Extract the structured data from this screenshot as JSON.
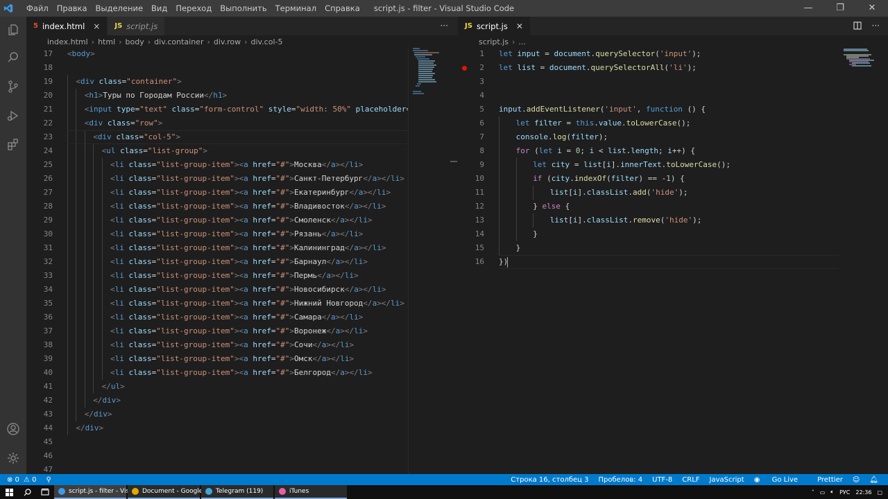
{
  "window": {
    "title": "script.js - filter - Visual Studio Code",
    "menu": [
      "Файл",
      "Правка",
      "Выделение",
      "Вид",
      "Переход",
      "Выполнить",
      "Терминал",
      "Справка"
    ],
    "controls": {
      "minimize": "—",
      "restore": "❐",
      "close": "✕"
    }
  },
  "left_editor": {
    "tabs": [
      {
        "label": "index.html",
        "icon": "html-file-icon",
        "close": "×",
        "active": true
      },
      {
        "label": "script.js",
        "icon": "js-file-icon",
        "active": false
      }
    ],
    "more": "···",
    "breadcrumb": [
      "index.html",
      "html",
      "body",
      "div.container",
      "div.row",
      "div.col-5"
    ],
    "lines": [
      {
        "n": "17",
        "html": "<span class='br'>&lt;</span><span class='tg'>body</span><span class='br'>&gt;</span>",
        "indent": 0
      },
      {
        "n": "18",
        "html": "",
        "indent": 0
      },
      {
        "n": "19",
        "html": "<span class='br'>&lt;</span><span class='tg'>div</span> <span class='at'>class</span><span class='pl'>=</span><span class='st'>\"container\"</span><span class='br'>&gt;</span>",
        "indent": 1
      },
      {
        "n": "20",
        "html": "<span class='br'>&lt;</span><span class='tg'>h1</span><span class='br'>&gt;</span><span class='pl'>Туры по Городам России</span><span class='br'>&lt;/</span><span class='tg'>h1</span><span class='br'>&gt;</span>",
        "indent": 2
      },
      {
        "n": "21",
        "html": "<span class='br'>&lt;</span><span class='tg'>input</span> <span class='at'>type</span><span class='pl'>=</span><span class='st'>\"text\"</span> <span class='at'>class</span><span class='pl'>=</span><span class='st'>\"form-control\"</span> <span class='at'>style</span><span class='pl'>=</span><span class='st'>\"width: 50%\"</span> <span class='at'>placeholder</span><span class='pl'>=</span><span class='st'>\"Введ</span>",
        "indent": 2
      },
      {
        "n": "22",
        "html": "<span class='br'>&lt;</span><span class='tg'>div</span> <span class='at'>class</span><span class='pl'>=</span><span class='st'>\"row\"</span><span class='br'>&gt;</span>",
        "indent": 2
      },
      {
        "n": "23",
        "html": "<span class='br'>&lt;</span><span class='tg'>div</span> <span class='at'>class</span><span class='pl'>=</span><span class='st'>\"col-5\"</span><span class='br'>&gt;</span>",
        "indent": 3
      },
      {
        "n": "24",
        "html": "<span class='br'>&lt;</span><span class='tg'>ul</span> <span class='at'>class</span><span class='pl'>=</span><span class='st'>\"list-group\"</span><span class='br'>&gt;</span>",
        "indent": 4
      },
      {
        "n": "25",
        "city": "Москва",
        "indent": 5
      },
      {
        "n": "26",
        "city": "Санкт-Петербург",
        "indent": 5
      },
      {
        "n": "27",
        "city": "Екатеринбург",
        "indent": 5
      },
      {
        "n": "28",
        "city": "Владивосток",
        "indent": 5
      },
      {
        "n": "29",
        "city": "Смоленск",
        "indent": 5
      },
      {
        "n": "30",
        "city": "Рязань",
        "indent": 5
      },
      {
        "n": "31",
        "city": "Калининград",
        "indent": 5
      },
      {
        "n": "32",
        "city": "Барнаул",
        "indent": 5
      },
      {
        "n": "33",
        "city": "Пермь",
        "indent": 5
      },
      {
        "n": "34",
        "city": "Новосибирск",
        "indent": 5
      },
      {
        "n": "35",
        "city": "Нижний Новгород",
        "indent": 5
      },
      {
        "n": "36",
        "city": "Самара",
        "indent": 5
      },
      {
        "n": "37",
        "city": "Воронеж",
        "indent": 5
      },
      {
        "n": "38",
        "city": "Сочи",
        "indent": 5
      },
      {
        "n": "39",
        "city": "Омск",
        "indent": 5
      },
      {
        "n": "40",
        "city": "Белгород",
        "indent": 5
      },
      {
        "n": "41",
        "html": "<span class='br'>&lt;/</span><span class='tg'>ul</span><span class='br'>&gt;</span>",
        "indent": 4
      },
      {
        "n": "42",
        "html": "<span class='br'>&lt;/</span><span class='tg'>div</span><span class='br'>&gt;</span>",
        "indent": 3
      },
      {
        "n": "43",
        "html": "<span class='br'>&lt;/</span><span class='tg'>div</span><span class='br'>&gt;</span>",
        "indent": 2
      },
      {
        "n": "44",
        "html": "<span class='br'>&lt;/</span><span class='tg'>div</span><span class='br'>&gt;</span>",
        "indent": 1
      },
      {
        "n": "45",
        "html": "",
        "indent": 0
      },
      {
        "n": "46",
        "html": "",
        "indent": 0
      },
      {
        "n": "47",
        "html": "",
        "indent": 0
      }
    ]
  },
  "right_editor": {
    "tabs": [
      {
        "label": "script.js",
        "icon": "js-file-icon",
        "close": "✕",
        "active": true
      }
    ],
    "breadcrumb": [
      "script.js",
      "..."
    ],
    "lines": [
      {
        "n": "1",
        "html": "<span class='kw'>let</span> <span class='vr'>input</span> <span class='pl'>=</span> <span class='vr'>document</span><span class='pl'>.</span><span class='fn'>querySelector</span><span class='pl'>(</span><span class='st'>'input'</span><span class='pl'>);</span>",
        "indent": 0
      },
      {
        "n": "2",
        "html": "<span class='kw'>let</span> <span class='vr'>list</span> <span class='pl'>=</span> <span class='vr'>document</span><span class='pl'>.</span><span class='fn'>querySelectorAll</span><span class='pl'>(</span><span class='st'>'li'</span><span class='pl'>);</span>",
        "indent": 0,
        "breakpoint": true
      },
      {
        "n": "3",
        "html": "",
        "indent": 0
      },
      {
        "n": "4",
        "html": "",
        "indent": 0
      },
      {
        "n": "5",
        "html": "<span class='vr'>input</span><span class='pl'>.</span><span class='fn'>addEventListener</span><span class='pl'>(</span><span class='st'>'input'</span><span class='pl'>, </span><span class='kw'>function</span> <span class='pl'>() {</span>",
        "indent": 0
      },
      {
        "n": "6",
        "html": "<span class='kw'>let</span> <span class='vr'>filter</span> <span class='pl'>=</span> <span class='kw'>this</span><span class='pl'>.</span><span class='vr'>value</span><span class='pl'>.</span><span class='fn'>toLowerCase</span><span class='pl'>();</span>",
        "indent": 1
      },
      {
        "n": "7",
        "html": "<span class='vr'>console</span><span class='pl'>.</span><span class='fn'>log</span><span class='pl'>(</span><span class='vr'>filter</span><span class='pl'>);</span>",
        "indent": 1
      },
      {
        "n": "8",
        "html": "<span class='kc'>for</span> <span class='pl'>(</span><span class='kw'>let</span> <span class='vr'>i</span> <span class='pl'>=</span> <span class='nm'>0</span><span class='pl'>; </span><span class='vr'>i</span> <span class='pl'>&lt;</span> <span class='vr'>list</span><span class='pl'>.</span><span class='vr'>length</span><span class='pl'>; </span><span class='vr'>i</span><span class='pl'>++) {</span>",
        "indent": 1
      },
      {
        "n": "9",
        "html": "<span class='kw'>let</span> <span class='vr'>city</span> <span class='pl'>=</span> <span class='vr'>list</span><span class='pl'>[</span><span class='vr'>i</span><span class='pl'>].</span><span class='vr'>innerText</span><span class='pl'>.</span><span class='fn'>toLowerCase</span><span class='pl'>();</span>",
        "indent": 2
      },
      {
        "n": "10",
        "html": "<span class='kc'>if</span> <span class='pl'>(</span><span class='vr'>city</span><span class='pl'>.</span><span class='fn'>indexOf</span><span class='pl'>(</span><span class='vr'>filter</span><span class='pl'>) == -</span><span class='nm'>1</span><span class='pl'>) {</span>",
        "indent": 2
      },
      {
        "n": "11",
        "html": "<span class='vr'>list</span><span class='pl'>[</span><span class='vr'>i</span><span class='pl'>].</span><span class='vr'>classList</span><span class='pl'>.</span><span class='fn'>add</span><span class='pl'>(</span><span class='st'>'hide'</span><span class='pl'>);</span>",
        "indent": 3
      },
      {
        "n": "12",
        "html": "<span class='pl'>} </span><span class='kc'>else</span> <span class='pl'>{</span>",
        "indent": 2
      },
      {
        "n": "13",
        "html": "<span class='vr'>list</span><span class='pl'>[</span><span class='vr'>i</span><span class='pl'>].</span><span class='vr'>classList</span><span class='pl'>.</span><span class='fn'>remove</span><span class='pl'>(</span><span class='st'>'hide'</span><span class='pl'>);</span>",
        "indent": 3
      },
      {
        "n": "14",
        "html": "<span class='pl'>}</span>",
        "indent": 2
      },
      {
        "n": "15",
        "html": "<span class='pl'>}</span>",
        "indent": 1
      },
      {
        "n": "16",
        "html": "<span class='pl'>})</span>",
        "indent": 0
      }
    ]
  },
  "statusbar": {
    "errors": "⊗ 0",
    "warnings": "⚠ 0",
    "position": "Строка 16, столбец 3",
    "spaces": "Пробелов: 4",
    "encoding": "UTF-8",
    "eol": "CRLF",
    "language": "JavaScript",
    "golive": "Go Live",
    "prettier": "Prettier"
  },
  "taskbar": {
    "apps": [
      {
        "label": "script.js - filter - Visua...",
        "icon": "vscode-icon",
        "color": "#3c9be8",
        "active": true
      },
      {
        "label": "Document - Google ...",
        "icon": "chrome-icon",
        "color": "#e0a800",
        "active": false
      },
      {
        "label": "Telegram (119)",
        "icon": "telegram-icon",
        "color": "#3ea5dd",
        "active": false
      },
      {
        "label": "iTunes",
        "icon": "itunes-icon",
        "color": "#e85ea8",
        "active": false
      }
    ],
    "tray": {
      "lang": "РУС",
      "time": "22:36"
    }
  },
  "colors": {
    "accent": "#007acc",
    "html_icon": "#e44d26",
    "js_icon": "#f0d447",
    "breakpoint": "#e51400"
  }
}
